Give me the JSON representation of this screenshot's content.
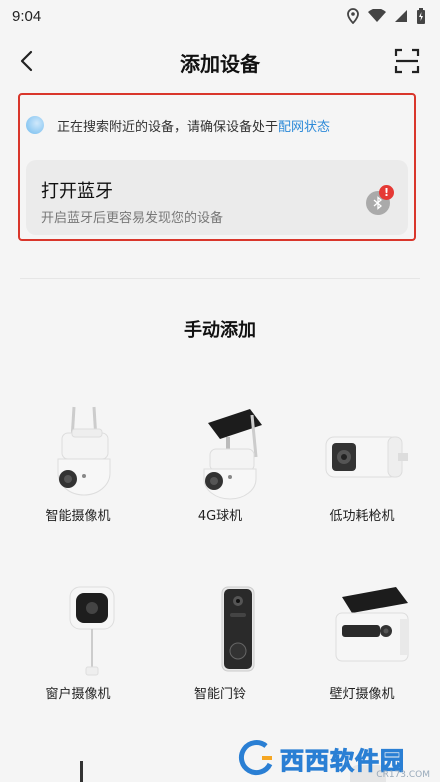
{
  "status_bar": {
    "time": "9:04",
    "icons": [
      "location-icon",
      "wifi-icon",
      "signal-icon",
      "battery-icon"
    ]
  },
  "header": {
    "title": "添加设备",
    "back_icon": "chevron-left-icon",
    "scan_icon": "scan-icon"
  },
  "search": {
    "text": "正在搜索附近的设备，请确保设备处于",
    "link": "配网状态"
  },
  "bluetooth_card": {
    "title": "打开蓝牙",
    "subtitle": "开启蓝牙后更容易发现您的设备",
    "alert": "!"
  },
  "manual": {
    "title": "手动添加"
  },
  "devices": [
    {
      "label": "智能摄像机",
      "icon": "ptz-camera-icon"
    },
    {
      "label": "4G球机",
      "icon": "solar-ptz-camera-icon"
    },
    {
      "label": "低功耗枪机",
      "icon": "bullet-camera-icon"
    },
    {
      "label": "窗户摄像机",
      "icon": "window-camera-icon"
    },
    {
      "label": "智能门铃",
      "icon": "doorbell-icon"
    },
    {
      "label": "壁灯摄像机",
      "icon": "floodlight-camera-icon"
    }
  ],
  "watermark": {
    "text": "西西软件园",
    "sub": "CR173.COM"
  },
  "colors": {
    "highlight_border": "#d9362b",
    "link": "#2d8ad8",
    "alert": "#e53935"
  }
}
